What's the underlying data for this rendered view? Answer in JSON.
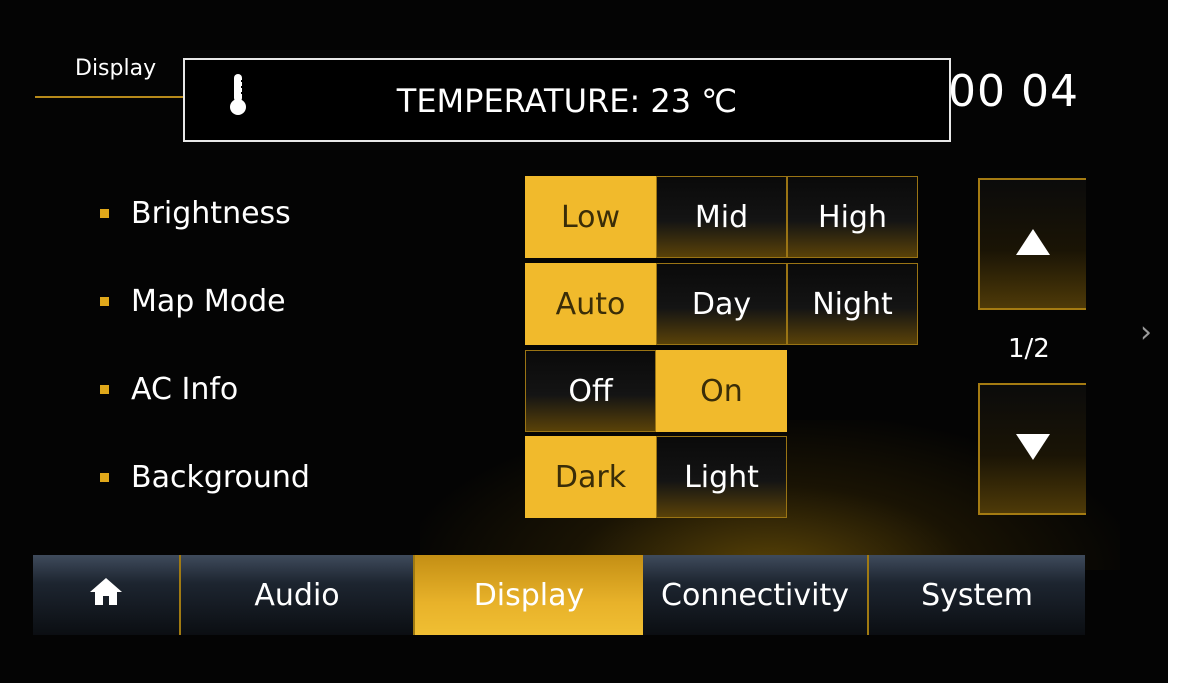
{
  "header": {
    "title": "Display",
    "clock": "00 04"
  },
  "popup": {
    "icon": "thermometer-icon",
    "text": "TEMPERATURE: 23 ℃"
  },
  "settings": [
    {
      "label": "Brightness",
      "options": [
        "Low",
        "Mid",
        "High"
      ],
      "selected": "Low"
    },
    {
      "label": "Map Mode",
      "options": [
        "Auto",
        "Day",
        "Night"
      ],
      "selected": "Auto"
    },
    {
      "label": "AC Info",
      "options": [
        "Off",
        "On"
      ],
      "selected": "On"
    },
    {
      "label": "Background",
      "options": [
        "Dark",
        "Light"
      ],
      "selected": "Dark"
    }
  ],
  "pager": {
    "indicator": "1/2",
    "up_icon": "triangle-up-icon",
    "down_icon": "triangle-down-icon"
  },
  "tabs": {
    "home_icon": "home-icon",
    "audio": "Audio",
    "display": "Display",
    "connectivity": "Connectivity",
    "system": "System",
    "active": "Display"
  },
  "colors": {
    "accent": "#f1ba2c",
    "accent_dark": "#a47b12",
    "background": "#040404"
  }
}
